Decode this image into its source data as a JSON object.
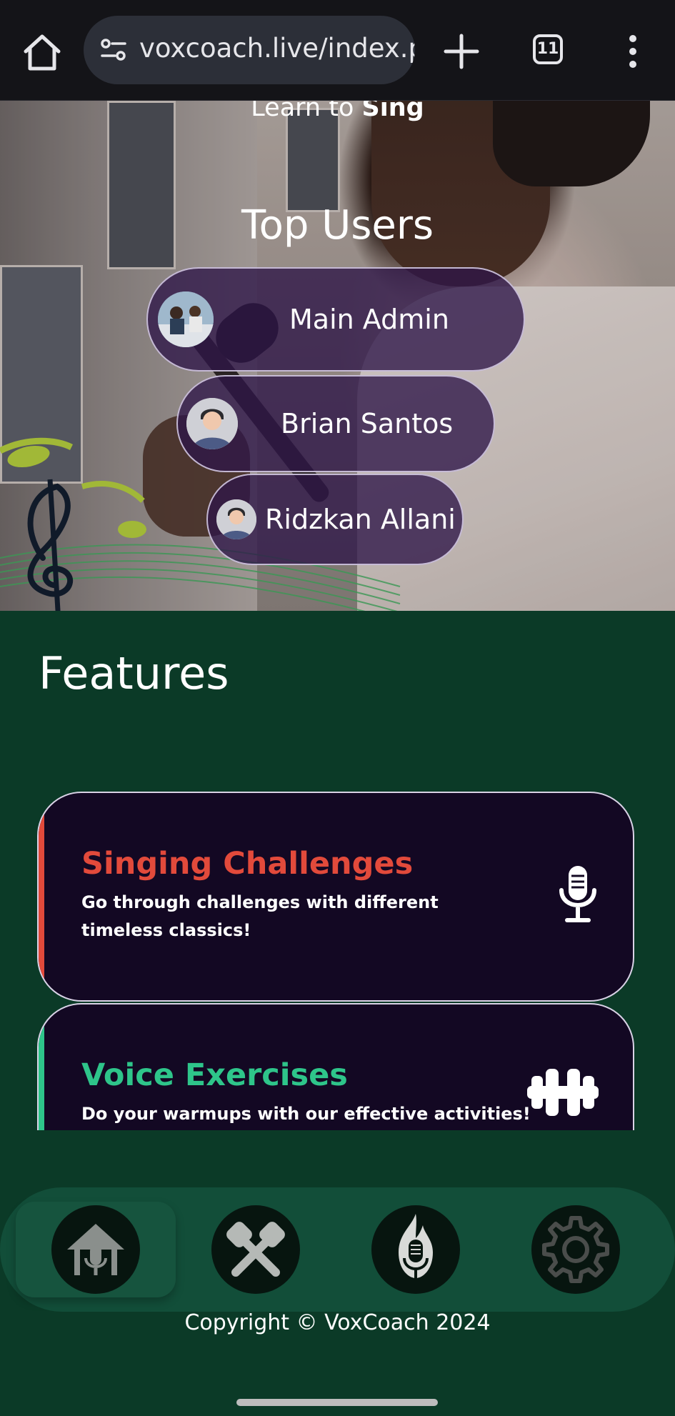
{
  "browser": {
    "url": "voxcoach.live/index.p",
    "tab_count": "11",
    "icons": [
      "home-icon",
      "site-settings-icon",
      "new-tab-icon",
      "tabs-icon",
      "menu-icon"
    ]
  },
  "hero": {
    "learn_prefix": "Learn to ",
    "learn_emphasis": "Sing",
    "top_users_title": "Top Users",
    "users": [
      {
        "name": "Main Admin"
      },
      {
        "name": "Brian Santos"
      },
      {
        "name": "Ridzkan Allani"
      }
    ]
  },
  "features": {
    "title": "Features",
    "cards": [
      {
        "title": "Singing Challenges",
        "description": "Go through challenges with different timeless classics!",
        "accent": "#e24a3b",
        "icon": "microphone-icon"
      },
      {
        "title": "Voice Exercises",
        "description": "Do your warmups with our effective activities!",
        "accent": "#2ec58a",
        "icon": "dumbbell-icon"
      }
    ]
  },
  "bottom_nav": {
    "items": [
      {
        "icon": "home-mic-icon",
        "active": true
      },
      {
        "icon": "crossed-mics-icon",
        "active": false
      },
      {
        "icon": "flame-mic-icon",
        "active": false
      },
      {
        "icon": "gear-icon",
        "active": false
      }
    ]
  },
  "footer": {
    "copyright": "Copyright © VoxCoach 2024"
  },
  "colors": {
    "page_bg": "#0b3a27",
    "nav_bg": "#124e39",
    "card_bg": "#130823",
    "pill_bg": "#2e1648"
  }
}
